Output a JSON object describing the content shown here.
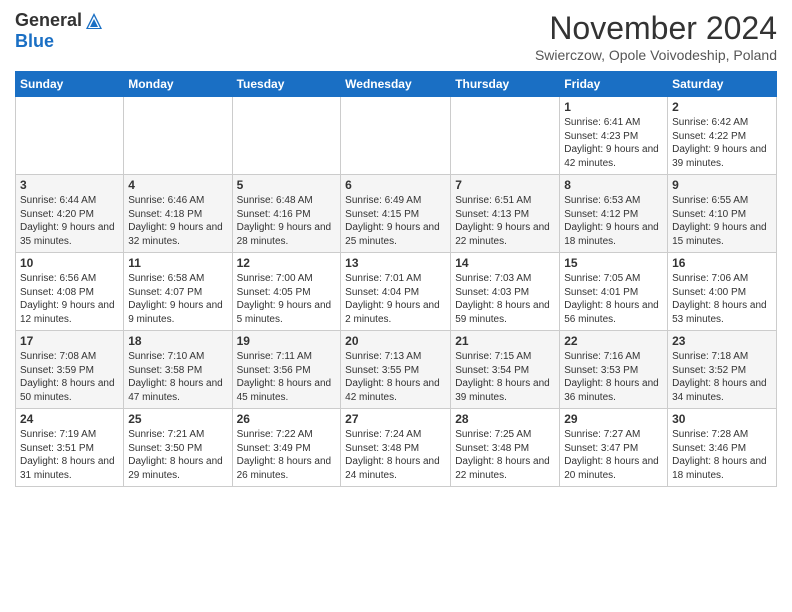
{
  "logo": {
    "general": "General",
    "blue": "Blue"
  },
  "title": "November 2024",
  "location": "Swierczow, Opole Voivodeship, Poland",
  "headers": [
    "Sunday",
    "Monday",
    "Tuesday",
    "Wednesday",
    "Thursday",
    "Friday",
    "Saturday"
  ],
  "weeks": [
    [
      {
        "day": "",
        "info": ""
      },
      {
        "day": "",
        "info": ""
      },
      {
        "day": "",
        "info": ""
      },
      {
        "day": "",
        "info": ""
      },
      {
        "day": "",
        "info": ""
      },
      {
        "day": "1",
        "info": "Sunrise: 6:41 AM\nSunset: 4:23 PM\nDaylight: 9 hours and 42 minutes."
      },
      {
        "day": "2",
        "info": "Sunrise: 6:42 AM\nSunset: 4:22 PM\nDaylight: 9 hours and 39 minutes."
      }
    ],
    [
      {
        "day": "3",
        "info": "Sunrise: 6:44 AM\nSunset: 4:20 PM\nDaylight: 9 hours and 35 minutes."
      },
      {
        "day": "4",
        "info": "Sunrise: 6:46 AM\nSunset: 4:18 PM\nDaylight: 9 hours and 32 minutes."
      },
      {
        "day": "5",
        "info": "Sunrise: 6:48 AM\nSunset: 4:16 PM\nDaylight: 9 hours and 28 minutes."
      },
      {
        "day": "6",
        "info": "Sunrise: 6:49 AM\nSunset: 4:15 PM\nDaylight: 9 hours and 25 minutes."
      },
      {
        "day": "7",
        "info": "Sunrise: 6:51 AM\nSunset: 4:13 PM\nDaylight: 9 hours and 22 minutes."
      },
      {
        "day": "8",
        "info": "Sunrise: 6:53 AM\nSunset: 4:12 PM\nDaylight: 9 hours and 18 minutes."
      },
      {
        "day": "9",
        "info": "Sunrise: 6:55 AM\nSunset: 4:10 PM\nDaylight: 9 hours and 15 minutes."
      }
    ],
    [
      {
        "day": "10",
        "info": "Sunrise: 6:56 AM\nSunset: 4:08 PM\nDaylight: 9 hours and 12 minutes."
      },
      {
        "day": "11",
        "info": "Sunrise: 6:58 AM\nSunset: 4:07 PM\nDaylight: 9 hours and 9 minutes."
      },
      {
        "day": "12",
        "info": "Sunrise: 7:00 AM\nSunset: 4:05 PM\nDaylight: 9 hours and 5 minutes."
      },
      {
        "day": "13",
        "info": "Sunrise: 7:01 AM\nSunset: 4:04 PM\nDaylight: 9 hours and 2 minutes."
      },
      {
        "day": "14",
        "info": "Sunrise: 7:03 AM\nSunset: 4:03 PM\nDaylight: 8 hours and 59 minutes."
      },
      {
        "day": "15",
        "info": "Sunrise: 7:05 AM\nSunset: 4:01 PM\nDaylight: 8 hours and 56 minutes."
      },
      {
        "day": "16",
        "info": "Sunrise: 7:06 AM\nSunset: 4:00 PM\nDaylight: 8 hours and 53 minutes."
      }
    ],
    [
      {
        "day": "17",
        "info": "Sunrise: 7:08 AM\nSunset: 3:59 PM\nDaylight: 8 hours and 50 minutes."
      },
      {
        "day": "18",
        "info": "Sunrise: 7:10 AM\nSunset: 3:58 PM\nDaylight: 8 hours and 47 minutes."
      },
      {
        "day": "19",
        "info": "Sunrise: 7:11 AM\nSunset: 3:56 PM\nDaylight: 8 hours and 45 minutes."
      },
      {
        "day": "20",
        "info": "Sunrise: 7:13 AM\nSunset: 3:55 PM\nDaylight: 8 hours and 42 minutes."
      },
      {
        "day": "21",
        "info": "Sunrise: 7:15 AM\nSunset: 3:54 PM\nDaylight: 8 hours and 39 minutes."
      },
      {
        "day": "22",
        "info": "Sunrise: 7:16 AM\nSunset: 3:53 PM\nDaylight: 8 hours and 36 minutes."
      },
      {
        "day": "23",
        "info": "Sunrise: 7:18 AM\nSunset: 3:52 PM\nDaylight: 8 hours and 34 minutes."
      }
    ],
    [
      {
        "day": "24",
        "info": "Sunrise: 7:19 AM\nSunset: 3:51 PM\nDaylight: 8 hours and 31 minutes."
      },
      {
        "day": "25",
        "info": "Sunrise: 7:21 AM\nSunset: 3:50 PM\nDaylight: 8 hours and 29 minutes."
      },
      {
        "day": "26",
        "info": "Sunrise: 7:22 AM\nSunset: 3:49 PM\nDaylight: 8 hours and 26 minutes."
      },
      {
        "day": "27",
        "info": "Sunrise: 7:24 AM\nSunset: 3:48 PM\nDaylight: 8 hours and 24 minutes."
      },
      {
        "day": "28",
        "info": "Sunrise: 7:25 AM\nSunset: 3:48 PM\nDaylight: 8 hours and 22 minutes."
      },
      {
        "day": "29",
        "info": "Sunrise: 7:27 AM\nSunset: 3:47 PM\nDaylight: 8 hours and 20 minutes."
      },
      {
        "day": "30",
        "info": "Sunrise: 7:28 AM\nSunset: 3:46 PM\nDaylight: 8 hours and 18 minutes."
      }
    ]
  ]
}
